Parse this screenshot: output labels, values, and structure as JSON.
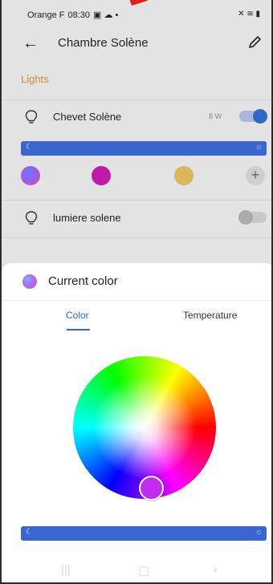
{
  "status": {
    "carrier": "Orange F",
    "time": "08:30",
    "left_icons": "▣ ☁ •",
    "right_icons": "✕ ≋ ▮"
  },
  "header": {
    "title": "Chambre Solène",
    "back_icon": "arrow-left-icon",
    "edit_icon": "pencil-icon"
  },
  "section_label": "Lights",
  "devices": [
    {
      "name": "Chevet Solène",
      "power": "8 W",
      "on": true
    },
    {
      "name": "lumiere solene",
      "power": "",
      "on": false
    }
  ],
  "slider_icons": {
    "low": "☾",
    "high": "☼"
  },
  "swatches": [
    {
      "name": "current",
      "color": "#7a5cf0"
    },
    {
      "name": "magenta",
      "color": "#c01aa8"
    },
    {
      "name": "yellow",
      "color": "#d9b85a"
    }
  ],
  "add_label": "+",
  "sheet": {
    "title": "Current color",
    "tabs": [
      {
        "label": "Color",
        "active": true
      },
      {
        "label": "Temperature",
        "active": false
      }
    ],
    "selected_color": "#c02cf0"
  },
  "nav": {
    "recents": "|||",
    "home": "▢",
    "back": "‹"
  },
  "colors": {
    "accent": "#3466c8",
    "section": "#d88a2a"
  }
}
